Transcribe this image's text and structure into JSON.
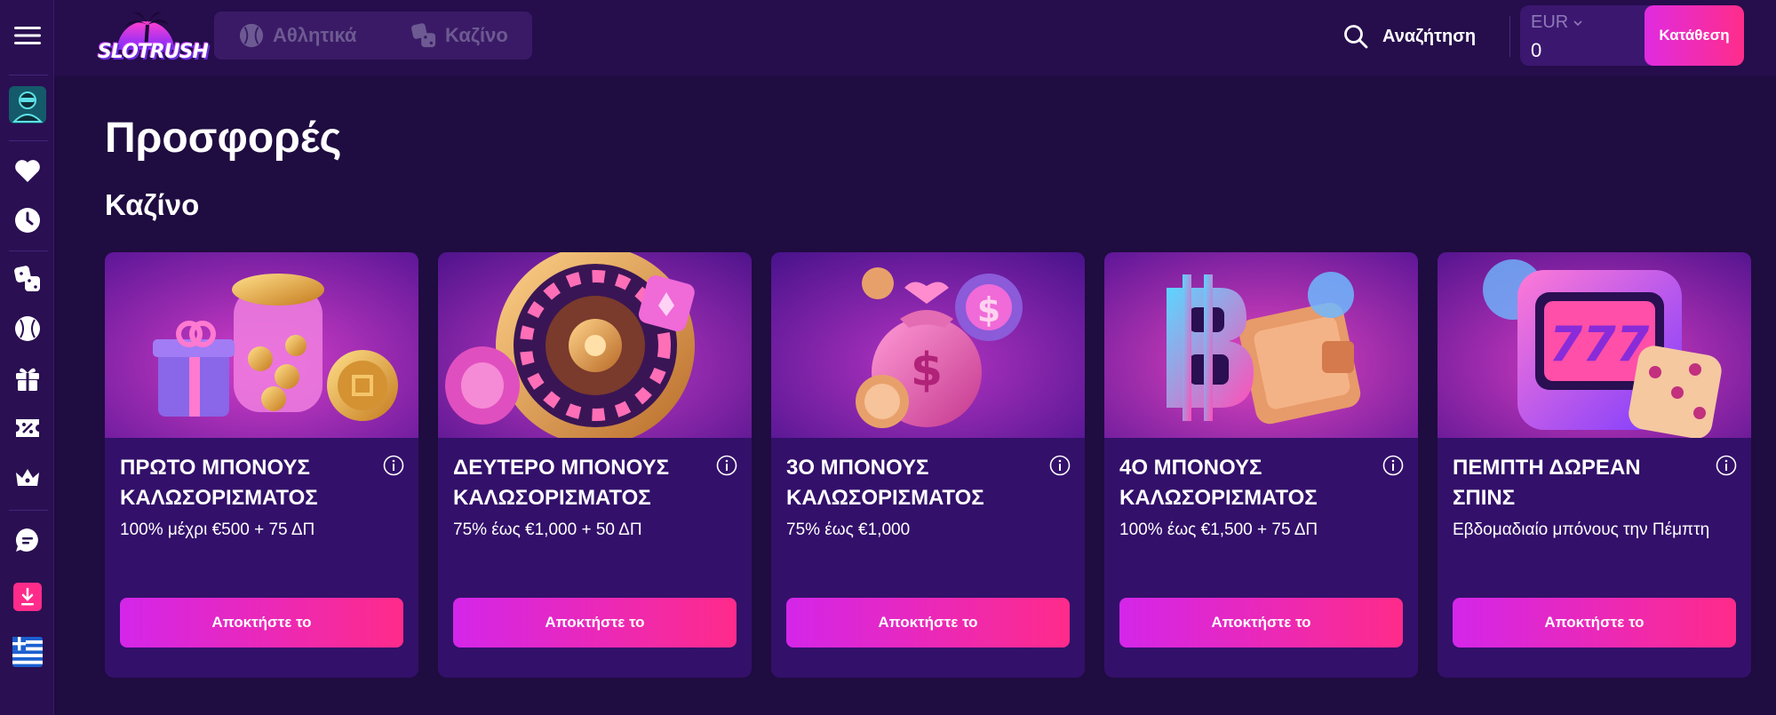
{
  "sidebar": {
    "items": [
      {
        "icon": "menu-icon"
      },
      {
        "icon": "avatar"
      },
      {
        "icon": "heart-icon"
      },
      {
        "icon": "clock-icon"
      },
      {
        "icon": "dice-icon"
      },
      {
        "icon": "baseball-icon"
      },
      {
        "icon": "gift-icon"
      },
      {
        "icon": "ticket-icon"
      },
      {
        "icon": "crown-icon"
      },
      {
        "icon": "chat-icon"
      },
      {
        "icon": "download-icon"
      },
      {
        "icon": "greek-flag-icon"
      }
    ]
  },
  "header": {
    "logo_text": "SLOTRUSH",
    "tabs": [
      {
        "label": "Αθλητικά",
        "icon": "baseball-icon"
      },
      {
        "label": "Καζίνο",
        "icon": "dice-icon"
      }
    ],
    "search_label": "Αναζήτηση",
    "currency": "EUR",
    "balance": "0",
    "deposit_label": "Κατάθεση"
  },
  "main": {
    "page_title": "Προσφορές",
    "section_title": "Καζίνο",
    "cards": [
      {
        "title_line1": "ΠΡΩΤΟ ΜΠΟΝΟΥΣ",
        "title_line2": "ΚΑΛΩΣΟΡΙΣΜΑΤΟΣ",
        "subtitle": "100% μέχρι €500 + 75 ΔΠ",
        "button": "Αποκτήστε το",
        "image": "gift-and-coin-jar"
      },
      {
        "title_line1": "ΔΕΥΤΕΡΟ ΜΠΟΝΟΥΣ",
        "title_line2": "ΚΑΛΩΣΟΡΙΣΜΑΤΟΣ",
        "subtitle": "75% έως €1,000 + 50 ΔΠ",
        "button": "Αποκτήστε το",
        "image": "roulette-wheel"
      },
      {
        "title_line1": "3Ο ΜΠΟΝΟΥΣ",
        "title_line2": "ΚΑΛΩΣΟΡΙΣΜΑΤΟΣ",
        "subtitle": "75% έως €1,000",
        "button": "Αποκτήστε το",
        "image": "money-bag-and-coins"
      },
      {
        "title_line1": "4Ο ΜΠΟΝΟΥΣ",
        "title_line2": "ΚΑΛΩΣΟΡΙΣΜΑΤΟΣ",
        "subtitle": "100% έως €1,500 + 75 ΔΠ",
        "button": "Αποκτήστε το",
        "image": "bitcoin-and-wallet"
      },
      {
        "title_line1": "ΠΕΜΠΤΗ ΔΩΡΕΑΝ",
        "title_line2": "ΣΠΙΝΣ",
        "subtitle": "Εβδομαδιαίο μπόνους την Πέμπτη",
        "button": "Αποκτήστε το",
        "image": "slot-machine-and-dice"
      }
    ]
  },
  "colors": {
    "background": "#1f0c40",
    "sidebar": "#2a0f52",
    "card": "#33106a",
    "accent_start": "#d426ea",
    "accent_end": "#ff2b8a"
  }
}
